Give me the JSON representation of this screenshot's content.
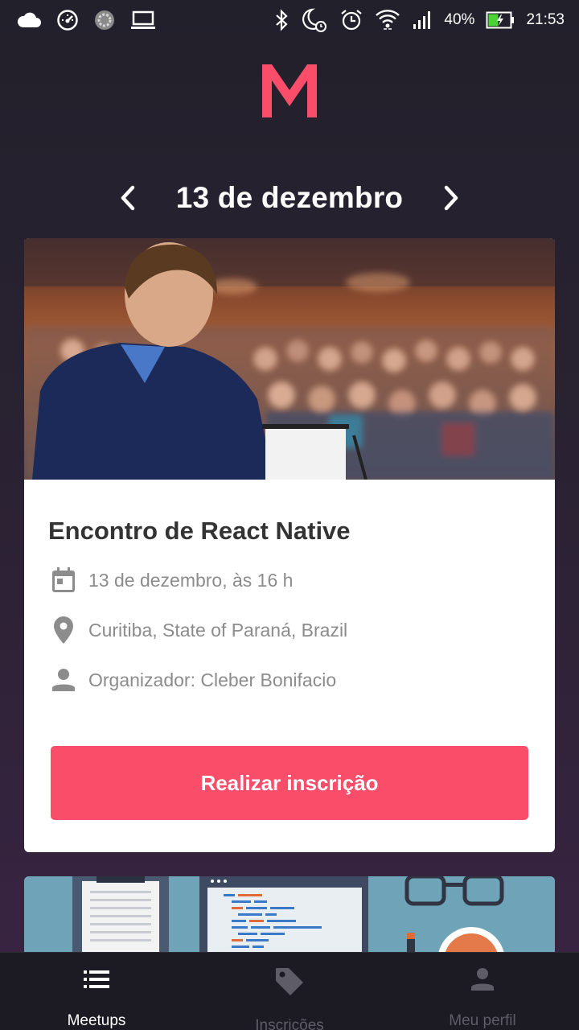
{
  "status_bar": {
    "battery": "40%",
    "time": "21:53",
    "icons_left": [
      "cloud-icon",
      "speedometer-icon",
      "sync-icon",
      "laptop-icon"
    ],
    "icons_right": [
      "bluetooth-icon",
      "moon-alarm-icon",
      "alarm-icon",
      "wifi-icon",
      "signal-icon",
      "battery-icon"
    ]
  },
  "header": {
    "logo_letter": "M",
    "brand_color": "#f94d6a"
  },
  "date_nav": {
    "date": "13 de dezembro"
  },
  "meetup": {
    "title": "Encontro de React Native",
    "date_time": "13 de dezembro, às 16 h",
    "location": "Curitiba, State of Paraná, Brazil",
    "organizer": "Organizador: Cleber Bonifacio",
    "subscribe_label": "Realizar inscrição"
  },
  "tabs": [
    {
      "label": "Meetups",
      "icon": "list-icon",
      "active": true
    },
    {
      "label": "Inscrições",
      "icon": "tag-icon",
      "active": false
    },
    {
      "label": "Meu perfil",
      "icon": "person-icon",
      "active": false
    }
  ]
}
